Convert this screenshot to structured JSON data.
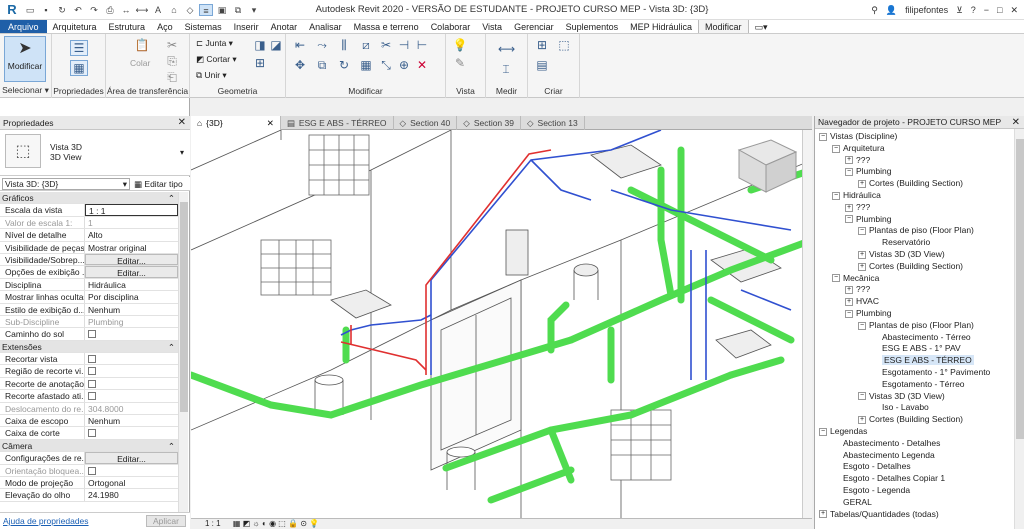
{
  "window": {
    "title": "Autodesk Revit 2020 - VERSÃO DE ESTUDANTE - PROJETO CURSO MEP - Vista 3D: {3D}",
    "user": "filipefontes"
  },
  "menu": [
    "Arquivo",
    "Arquitetura",
    "Estrutura",
    "Aço",
    "Sistemas",
    "Inserir",
    "Anotar",
    "Analisar",
    "Massa e terreno",
    "Colaborar",
    "Vista",
    "Gerenciar",
    "Suplementos",
    "MEP Hidráulica",
    "Modificar"
  ],
  "ribbon": {
    "modify_label": "Modificar",
    "select_label": "Selecionar ▾",
    "properties_label": "Propriedades",
    "clipboard_label": "Área de transferência",
    "paste_label": "Colar",
    "geometry_label": "Geometria",
    "join_label": "Junta",
    "cut_label": "Cortar",
    "unite_label": "Unir",
    "modify_group_label": "Modificar",
    "view_label": "Vista",
    "measure_label": "Medir",
    "create_label": "Criar"
  },
  "properties": {
    "title": "Propriedades",
    "type_name_1": "Vista 3D",
    "type_name_2": "3D View",
    "filter_value": "Vista 3D: {3D}",
    "edit_type": "Editar tipo",
    "rows": [
      {
        "k": "Gráficos",
        "section": true
      },
      {
        "k": "Escala da vista",
        "v": "1 : 1",
        "input": true
      },
      {
        "k": "Valor de escala    1:",
        "v": "1",
        "disabled": true
      },
      {
        "k": "Nível de detalhe",
        "v": "Alto"
      },
      {
        "k": "Visibilidade de peças",
        "v": "Mostrar original"
      },
      {
        "k": "Visibilidade/Sobrep...",
        "v": "Editar...",
        "button": true
      },
      {
        "k": "Opções de exibição ...",
        "v": "Editar...",
        "button": true
      },
      {
        "k": "Disciplina",
        "v": "Hidráulica"
      },
      {
        "k": "Mostrar linhas ocultas",
        "v": "Por disciplina"
      },
      {
        "k": "Estilo de exibição d...",
        "v": "Nenhum"
      },
      {
        "k": "Sub-Discipline",
        "v": "Plumbing",
        "disabled": true
      },
      {
        "k": "Caminho do sol",
        "v": "",
        "checkbox": true
      },
      {
        "k": "Extensões",
        "section": true
      },
      {
        "k": "Recortar vista",
        "v": "",
        "checkbox": true
      },
      {
        "k": "Região de recorte vi...",
        "v": "",
        "checkbox": true
      },
      {
        "k": "Recorte de anotação",
        "v": "",
        "checkbox": true
      },
      {
        "k": "Recorte afastado ati...",
        "v": "",
        "checkbox": true
      },
      {
        "k": "Deslocamento do re...",
        "v": "304.8000",
        "disabled": true
      },
      {
        "k": "Caixa de escopo",
        "v": "Nenhum"
      },
      {
        "k": "Caixa de corte",
        "v": "",
        "checkbox": true
      },
      {
        "k": "Câmera",
        "section": true
      },
      {
        "k": "Configurações de re...",
        "v": "Editar...",
        "button": true
      },
      {
        "k": "Orientação bloquea...",
        "v": "",
        "checkbox": true,
        "disabled": true
      },
      {
        "k": "Modo de projeção",
        "v": "Ortogonal"
      },
      {
        "k": "Elevação do olho",
        "v": "24.1980"
      }
    ],
    "help_link": "Ajuda de propriedades",
    "apply": "Aplicar"
  },
  "tabs": [
    {
      "label": "{3D}",
      "active": true
    },
    {
      "label": "ESG E ABS - TÉRREO"
    },
    {
      "label": "Section 40"
    },
    {
      "label": "Section 39"
    },
    {
      "label": "Section 13"
    }
  ],
  "view_bar": {
    "scale": "1 : 1"
  },
  "browser": {
    "title": "Navegador de projeto - PROJETO CURSO MEP",
    "items": [
      {
        "t": "Vistas (Discipline)",
        "l": 0,
        "pm": "−"
      },
      {
        "t": "Arquitetura",
        "l": 1,
        "pm": "−"
      },
      {
        "t": "???",
        "l": 2,
        "pm": "+"
      },
      {
        "t": "Plumbing",
        "l": 2,
        "pm": "−"
      },
      {
        "t": "Cortes (Building Section)",
        "l": 3,
        "pm": "+"
      },
      {
        "t": "Hidráulica",
        "l": 1,
        "pm": "−"
      },
      {
        "t": "???",
        "l": 2,
        "pm": "+"
      },
      {
        "t": "Plumbing",
        "l": 2,
        "pm": "−"
      },
      {
        "t": "Plantas de piso (Floor Plan)",
        "l": 3,
        "pm": "−"
      },
      {
        "t": "Reservatório",
        "l": 4
      },
      {
        "t": "Vistas 3D (3D View)",
        "l": 3,
        "pm": "+"
      },
      {
        "t": "Cortes (Building Section)",
        "l": 3,
        "pm": "+"
      },
      {
        "t": "Mecânica",
        "l": 1,
        "pm": "−"
      },
      {
        "t": "???",
        "l": 2,
        "pm": "+"
      },
      {
        "t": "HVAC",
        "l": 2,
        "pm": "+"
      },
      {
        "t": "Plumbing",
        "l": 2,
        "pm": "−"
      },
      {
        "t": "Plantas de piso (Floor Plan)",
        "l": 3,
        "pm": "−"
      },
      {
        "t": "Abastecimento - Térreo",
        "l": 4
      },
      {
        "t": "ESG E ABS - 1° PAV",
        "l": 4
      },
      {
        "t": "ESG E ABS - TÉRREO",
        "l": 4,
        "hl": true
      },
      {
        "t": "Esgotamento - 1° Pavimento",
        "l": 4
      },
      {
        "t": "Esgotamento - Térreo",
        "l": 4
      },
      {
        "t": "Vistas 3D (3D View)",
        "l": 3,
        "pm": "−"
      },
      {
        "t": "Iso - Lavabo",
        "l": 4
      },
      {
        "t": "Cortes (Building Section)",
        "l": 3,
        "pm": "+"
      },
      {
        "t": "Legendas",
        "l": 0,
        "pm": "−"
      },
      {
        "t": "Abastecimento - Detalhes",
        "l": 1
      },
      {
        "t": "Abastecimento Legenda",
        "l": 1
      },
      {
        "t": "Esgoto - Detalhes",
        "l": 1
      },
      {
        "t": "Esgoto - Detalhes Copiar 1",
        "l": 1
      },
      {
        "t": "Esgoto - Legenda",
        "l": 1
      },
      {
        "t": "GERAL",
        "l": 1
      },
      {
        "t": "Tabelas/Quantidades (todas)",
        "l": 0,
        "pm": "+"
      }
    ]
  },
  "colors": {
    "accent": "#1f5fa8",
    "pipe_green": "#4fdc4f",
    "pipe_blue": "#3050d0",
    "pipe_red": "#e03030"
  }
}
